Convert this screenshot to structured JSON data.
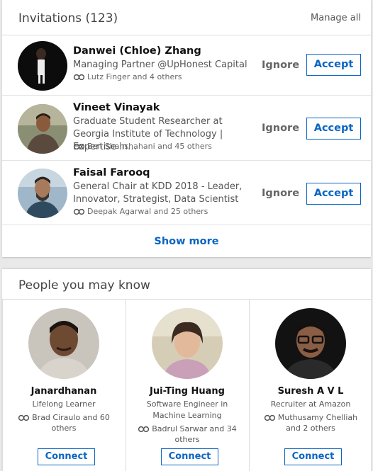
{
  "invitations": {
    "title": "Invitations (123)",
    "manage_all": "Manage all",
    "ignore_label": "Ignore",
    "accept_label": "Accept",
    "show_more": "Show more",
    "items": [
      {
        "name": "Danwei (Chloe) Zhang",
        "headline": "Managing Partner @UpHonest Capital",
        "mutual": "Lutz Finger and 4 others"
      },
      {
        "name": "Vineet Vinayak",
        "headline": "Graduate Student Researcher at Georgia Institute of Technology | Expertise in…",
        "mutual": "Ben Shahshahani and 45 others"
      },
      {
        "name": "Faisal Farooq",
        "headline": "General Chair at KDD 2018 - Leader, Innovator, Strategist, Data Scientist",
        "mutual": "Deepak Agarwal and 25 others"
      }
    ]
  },
  "pymk": {
    "title": "People you may know",
    "connect_label": "Connect",
    "people": [
      {
        "name": "Janardhanan",
        "headline": "Lifelong Learner",
        "mutual": "Brad Ciraulo and 60 others"
      },
      {
        "name": "Jui-Ting Huang",
        "headline": "Software Engineer in Machine Learning",
        "mutual": "Badrul Sarwar and 34 others"
      },
      {
        "name": "Suresh A V L",
        "headline": "Recruiter at Amazon",
        "mutual": "Muthusamy Chelliah and 2 others"
      }
    ]
  },
  "colors": {
    "accent": "#0a66c2",
    "background": "#e9e9e9"
  },
  "icons": {
    "shared_connections": "shared-connections-icon"
  }
}
